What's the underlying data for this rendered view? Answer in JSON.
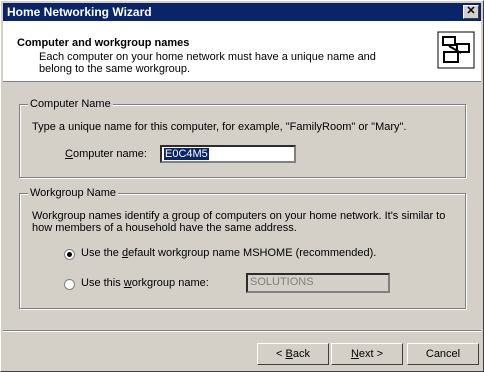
{
  "window": {
    "title": "Home Networking Wizard",
    "close_symbol": "✕"
  },
  "header": {
    "title": "Computer and workgroup names",
    "description": "Each computer on your home network must have a unique name and belong to the same workgroup.",
    "icon": "network-computers-icon"
  },
  "computer_group": {
    "legend": "Computer Name",
    "instructions": "Type a unique name for this computer, for example, \"FamilyRoom\" or \"Mary\".",
    "field_label_prefix": "",
    "field_label_key": "C",
    "field_label_rest": "omputer name:",
    "field_value": "E0C4M5"
  },
  "workgroup_group": {
    "legend": "Workgroup Name",
    "instructions": "Workgroup names identify a group of computers on your home network. It's similar to how members of a household have the same address.",
    "option1_prefix": "Use the ",
    "option1_key": "d",
    "option1_rest": "efault workgroup name MSHOME (recommended).",
    "option2_prefix": "Use this ",
    "option2_key": "w",
    "option2_rest": "orkgroup name:",
    "option2_value": "SOLUTIONS",
    "selected": "default"
  },
  "buttons": {
    "back_prefix": "< ",
    "back_key": "B",
    "back_rest": "ack",
    "next_key": "N",
    "next_rest": "ext >",
    "cancel": "Cancel"
  }
}
